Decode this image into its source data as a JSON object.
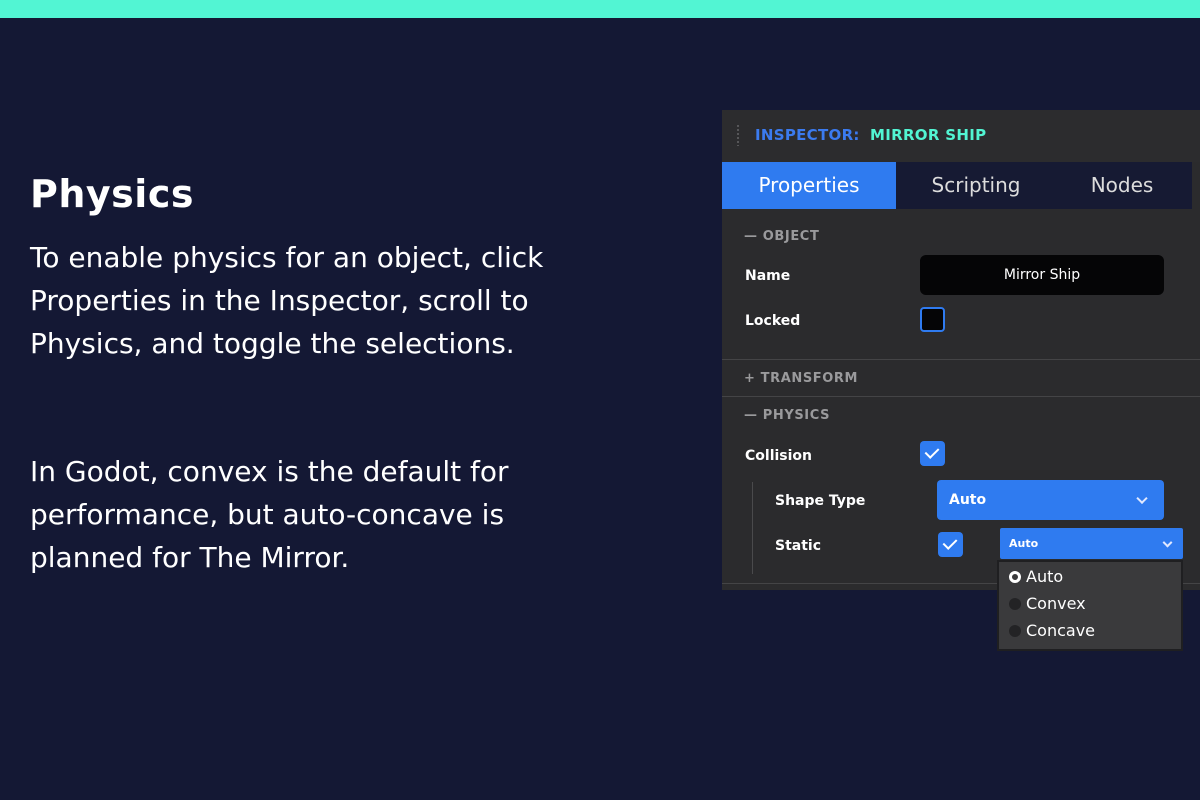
{
  "slide": {
    "title": "Physics",
    "paragraph1": "To enable physics for an object, click Properties in the Inspector, scroll to Physics, and toggle the selections.",
    "paragraph2": "In Godot, convex is the default for performance, but auto-concave is planned for The Mirror."
  },
  "inspector": {
    "label": "INSPECTOR:",
    "object_name": "MIRROR SHIP",
    "tabs": [
      {
        "label": "Properties",
        "active": true
      },
      {
        "label": "Scripting",
        "active": false
      },
      {
        "label": "Nodes",
        "active": false
      }
    ],
    "sections": {
      "object": "— OBJECT",
      "transform": "+ TRANSFORM",
      "physics": "— PHYSICS"
    },
    "fields": {
      "name_label": "Name",
      "name_value": "Mirror Ship",
      "locked_label": "Locked",
      "locked_checked": false,
      "collision_label": "Collision",
      "collision_checked": true,
      "shape_type_label": "Shape Type",
      "shape_type_value": "Auto",
      "static_label": "Static",
      "static_checked": true,
      "static_dropdown_value": "Auto"
    },
    "dropdown_options": [
      {
        "label": "Auto",
        "selected": true
      },
      {
        "label": "Convex",
        "selected": false
      },
      {
        "label": "Concave",
        "selected": false
      }
    ]
  },
  "colors": {
    "background": "#141834",
    "accent_teal": "#52f5d3",
    "accent_blue": "#2f7bf0",
    "panel": "#2b2b2d"
  }
}
